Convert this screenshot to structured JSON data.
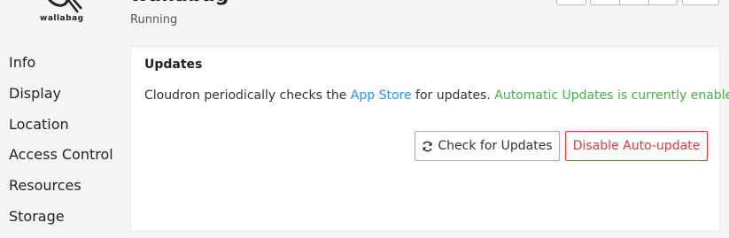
{
  "header": {
    "logo_text": "wallabag",
    "app_title": "wallabag",
    "status": "Running"
  },
  "sidebar": {
    "items": [
      {
        "label": "Info"
      },
      {
        "label": "Display"
      },
      {
        "label": "Location"
      },
      {
        "label": "Access Control"
      },
      {
        "label": "Resources"
      },
      {
        "label": "Storage"
      }
    ]
  },
  "updates": {
    "title": "Updates",
    "text_before": "Cloudron periodically checks the ",
    "link": "App Store",
    "text_after": " for updates. ",
    "status_text": "Automatic Updates is currently enabled.",
    "check_button": "Check for Updates",
    "disable_button": "Disable Auto-update"
  },
  "colors": {
    "link": "#2196f3",
    "success": "#4caf50",
    "danger": "#e53935"
  }
}
